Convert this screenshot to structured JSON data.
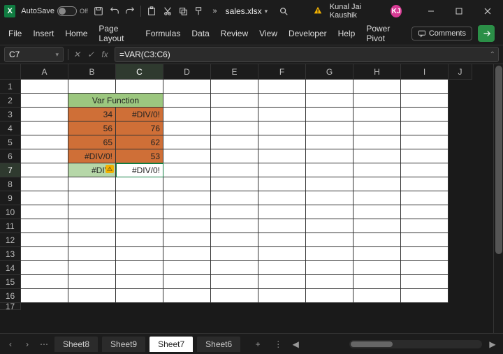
{
  "title": {
    "autosave_label": "AutoSave",
    "autosave_state": "Off",
    "filename": "sales.xlsx",
    "username": "Kunal Jai Kaushik",
    "userinitials": "KJ"
  },
  "ribbon": {
    "tabs": [
      "File",
      "Insert",
      "Home",
      "Page Layout",
      "Formulas",
      "Data",
      "Review",
      "View",
      "Developer",
      "Help",
      "Power Pivot"
    ],
    "comments_label": "Comments"
  },
  "formula": {
    "namebox": "C7",
    "fx_label": "fx",
    "formula_text": "=VAR(C3:C6)"
  },
  "grid": {
    "columns": [
      "A",
      "B",
      "C",
      "D",
      "E",
      "F",
      "G",
      "H",
      "I",
      "J"
    ],
    "rows": [
      "1",
      "2",
      "3",
      "4",
      "5",
      "6",
      "7",
      "8",
      "9",
      "10",
      "11",
      "12",
      "13",
      "14",
      "15",
      "16",
      "17"
    ],
    "selected_col": "C",
    "selected_row": "7",
    "merged_title": "Var Function",
    "data": {
      "B3": "34",
      "C3": "#DIV/0!",
      "B4": "56",
      "C4": "76",
      "B5": "65",
      "C5": "62",
      "B6": "#DIV/0!",
      "C6": "53",
      "B7": "#DIV/",
      "C7": "#DIV/0!"
    }
  },
  "sheets": {
    "tabs": [
      "Sheet8",
      "Sheet9",
      "Sheet7",
      "Sheet6"
    ],
    "active": "Sheet7",
    "add_label": "+"
  },
  "chart_data": null
}
